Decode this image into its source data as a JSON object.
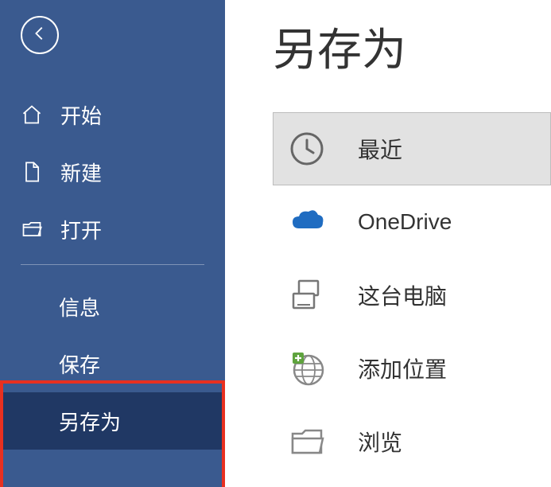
{
  "sidebar": {
    "items": [
      {
        "label": "开始"
      },
      {
        "label": "新建"
      },
      {
        "label": "打开"
      },
      {
        "label": "信息"
      },
      {
        "label": "保存"
      },
      {
        "label": "另存为"
      }
    ]
  },
  "main": {
    "title": "另存为",
    "locations": [
      {
        "label": "最近"
      },
      {
        "label": "OneDrive"
      },
      {
        "label": "这台电脑"
      },
      {
        "label": "添加位置"
      },
      {
        "label": "浏览"
      }
    ]
  }
}
